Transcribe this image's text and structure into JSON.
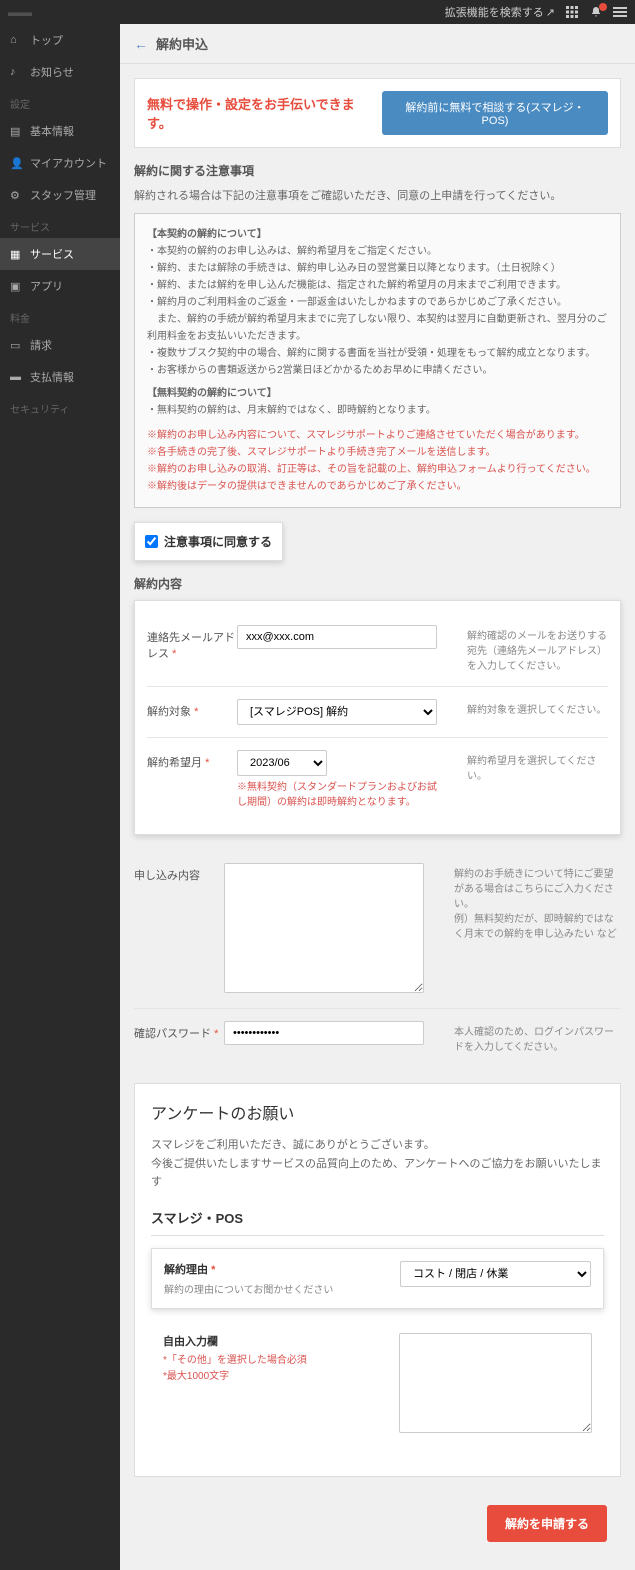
{
  "topbar": {
    "extension_search": "拡張機能を検索する"
  },
  "sidebar": {
    "items": [
      {
        "icon": "home",
        "label": "トップ"
      },
      {
        "icon": "bell",
        "label": "お知らせ"
      }
    ],
    "sections": [
      {
        "title": "設定",
        "items": [
          {
            "icon": "doc",
            "label": "基本情報"
          },
          {
            "icon": "user",
            "label": "マイアカウント"
          },
          {
            "icon": "users",
            "label": "スタッフ管理"
          }
        ]
      },
      {
        "title": "サービス",
        "items": [
          {
            "icon": "grid",
            "label": "サービス",
            "active": true
          },
          {
            "icon": "app",
            "label": "アプリ"
          }
        ]
      },
      {
        "title": "料金",
        "items": [
          {
            "icon": "card",
            "label": "請求"
          },
          {
            "icon": "credit",
            "label": "支払情報"
          }
        ]
      },
      {
        "title": "セキュリティ",
        "items": []
      }
    ]
  },
  "page": {
    "title": "解約申込"
  },
  "help_banner": {
    "text": "無料で操作・設定をお手伝いできます。",
    "button": "解約前に無料で相談する(スマレジ・POS)"
  },
  "notice": {
    "title": "解約に関する注意事項",
    "desc": "解約される場合は下記の注意事項をご確認いただき、同意の上申請を行ってください。",
    "sub1_title": "【本契約の解約について】",
    "lines": [
      "・本契約の解約のお申し込みは、解約希望月をご指定ください。",
      "・解約、または解除の手続きは、解約申し込み日の翌営業日以降となります。（土日祝除く）",
      "・解約、または解約を申し込んだ機能は、指定された解約希望月の月末までご利用できます。",
      "・解約月のご利用料金のご返金・一部返金はいたしかねますのであらかじめご了承ください。",
      "　また、解約の手続が解約希望月末までに完了しない限り、本契約は翌月に自動更新され、翌月分のご利用料金をお支払いいただきます。",
      "・複数サブスク契約中の場合、解約に関する書面を当社が受領・処理をもって解約成立となります。",
      "・お客様からの書類返送から2営業日ほどかかるためお早めに申請ください。"
    ],
    "sub2_title": "【無料契約の解約について】",
    "line2": "・無料契約の解約は、月末解約ではなく、即時解約となります。",
    "warnings": [
      "※解約のお申し込み内容について、スマレジサポートよりご連絡させていただく場合があります。",
      "※各手続きの完了後、スマレジサポートより手続き完了メールを送信します。",
      "※解約のお申し込みの取消、訂正等は、その旨を記載の上、解約申込フォームより行ってください。",
      "※解約後はデータの提供はできませんのであらかじめご了承ください。"
    ]
  },
  "agree": {
    "label": "注意事項に同意する"
  },
  "form": {
    "section_title": "解約内容",
    "email": {
      "label": "連絡先メールアドレス",
      "value": "xxx@xxx.com",
      "help": "解約確認のメールをお送りする宛先（連絡先メールアドレス）を入力してください。"
    },
    "target": {
      "label": "解約対象",
      "value": "[スマレジPOS] 解約",
      "help": "解約対象を選択してください。"
    },
    "month": {
      "label": "解約希望月",
      "value": "2023/06",
      "note": "※無料契約（スタンダードプランおよびお試し期間）の解約は即時解約となります。",
      "help": "解約希望月を選択してください。"
    },
    "content": {
      "label": "申し込み内容",
      "help": "解約のお手続きについて特にご要望がある場合はこちらにご入力ください。\n例）無料契約だが、即時解約ではなく月末での解約を申し込みたい など"
    },
    "password": {
      "label": "確認パスワード",
      "value": "••••••••••••",
      "help": "本人確認のため、ログインパスワードを入力してください。"
    }
  },
  "survey": {
    "title": "アンケートのお願い",
    "desc1": "スマレジをご利用いただき、誠にありがとうございます。",
    "desc2": "今後ご提供いたしますサービスの品質向上のため、アンケートへのご協力をお願いいたします",
    "sub": "スマレジ・POS",
    "reason": {
      "label": "解約理由",
      "hint": "解約の理由についてお聞かせください",
      "value": "コスト / 閉店 / 休業"
    },
    "freetext": {
      "label": "自由入力欄",
      "note1": "*「その他」を選択した場合必須",
      "note2": "*最大1000文字"
    }
  },
  "submit": {
    "label": "解約を申請する"
  }
}
